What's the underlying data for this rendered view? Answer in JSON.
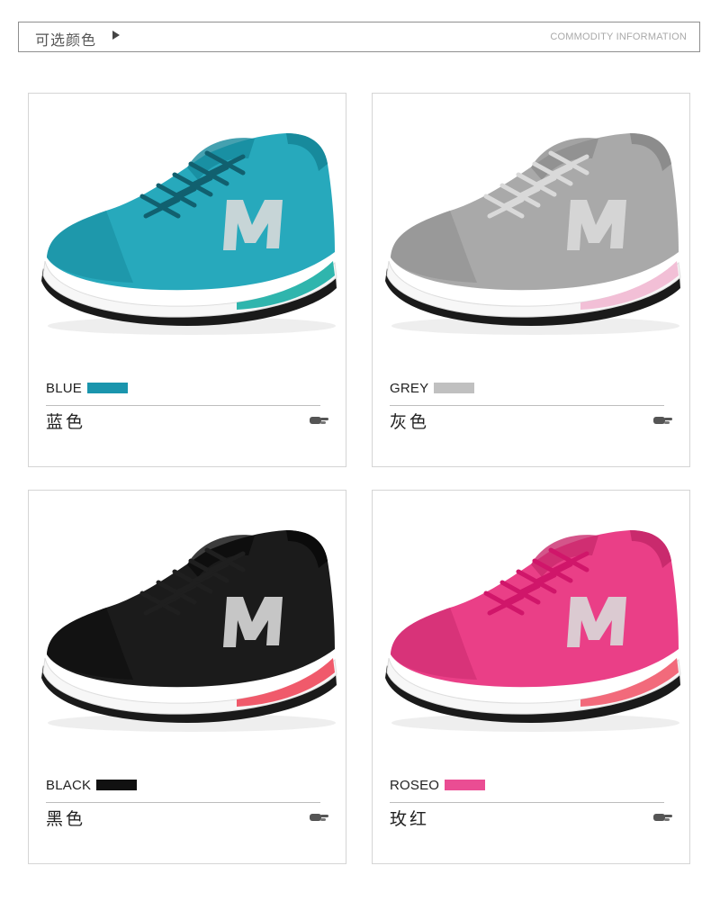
{
  "header": {
    "title": "可选颜色",
    "subtitle": "COMMODITY INFORMATION"
  },
  "colors": [
    {
      "en": "BLUE",
      "zh": "蓝色",
      "swatch": "#1a95ad",
      "upper": "#27a9bc",
      "upperDark": "#178a9c",
      "accent": "#2fb5ad",
      "lace": "#11606f"
    },
    {
      "en": "GREY",
      "zh": "灰色",
      "swatch": "#c0c0c0",
      "upper": "#a9a9a9",
      "upperDark": "#8c8c8c",
      "accent": "#f2bfd6",
      "lace": "#d9d9d9"
    },
    {
      "en": "BLACK",
      "zh": "黑色",
      "swatch": "#111111",
      "upper": "#1b1b1b",
      "upperDark": "#0b0b0b",
      "accent": "#f05a6b",
      "lace": "#1f1f1f"
    },
    {
      "en": "ROSEO",
      "zh": "玫红",
      "swatch": "#ea4d93",
      "upper": "#ea3f87",
      "upperDark": "#c92a6d",
      "accent": "#f26a7b",
      "lace": "#d0166a"
    }
  ]
}
